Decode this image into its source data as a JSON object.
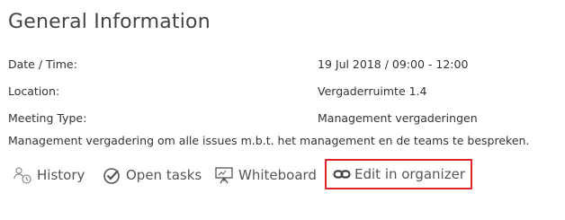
{
  "section": {
    "title": "General Information"
  },
  "details": [
    {
      "label": "Date / Time:",
      "value": "19 Jul 2018 / 09:00 - 12:00"
    },
    {
      "label": "Location:",
      "value": "Vergaderruimte 1.4"
    },
    {
      "label": "Meeting Type:",
      "value": "Management vergaderingen"
    }
  ],
  "description": "Management vergadering om alle issues m.b.t. het management en de teams te bespreken.",
  "actions": {
    "history": {
      "label": "History",
      "icon": "history-icon"
    },
    "open_tasks": {
      "label": "Open tasks",
      "icon": "check-circle-icon"
    },
    "whiteboard": {
      "label": "Whiteboard",
      "icon": "whiteboard-icon"
    },
    "edit_in_organizer": {
      "label": "Edit in organizer",
      "icon": "link-icon"
    }
  },
  "colors": {
    "highlight_border": "#e0232a",
    "text": "#333333",
    "action_text": "#555555"
  }
}
